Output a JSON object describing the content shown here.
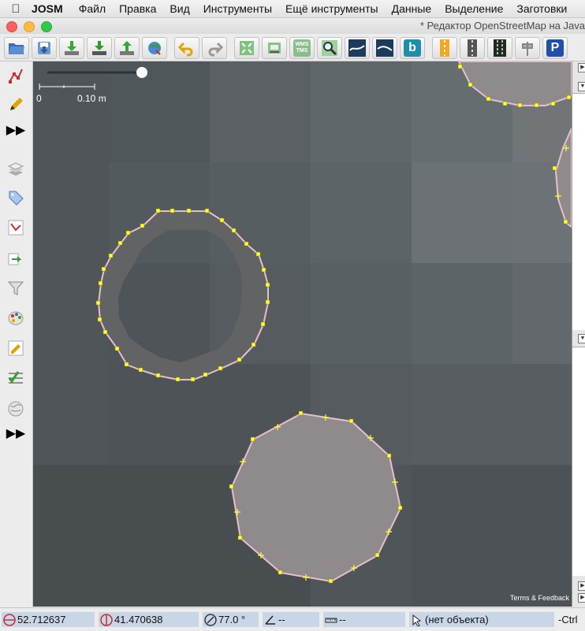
{
  "menubar": {
    "apple_icon": "apple-icon",
    "app_name": "JOSM",
    "items": [
      "Файл",
      "Правка",
      "Вид",
      "Инструменты",
      "Ещё инструменты",
      "Данные",
      "Выделение",
      "Заготовки"
    ]
  },
  "window": {
    "title": "* Редактор OpenStreetMap на Java"
  },
  "toolbar": {
    "wms_label": "WMS TMS",
    "bing_label": "b",
    "parking_label": "P"
  },
  "map": {
    "scale_start": "0",
    "scale_end": "0.10 m",
    "terms": "Terms & Feedback"
  },
  "statusbar": {
    "lat": "52.712637",
    "lon": "41.470638",
    "heading": "77.0 °",
    "angle": "--",
    "distance": "--",
    "object": "(нет объекта)",
    "ctrl": "-Ctrl"
  },
  "colors": {
    "map_bg": "#4a5053",
    "polygon_fill": "#8f8a8c",
    "polygon_stroke": "#e6c0c8",
    "node": "#ffff33",
    "status_field": "#c8d6e7"
  }
}
